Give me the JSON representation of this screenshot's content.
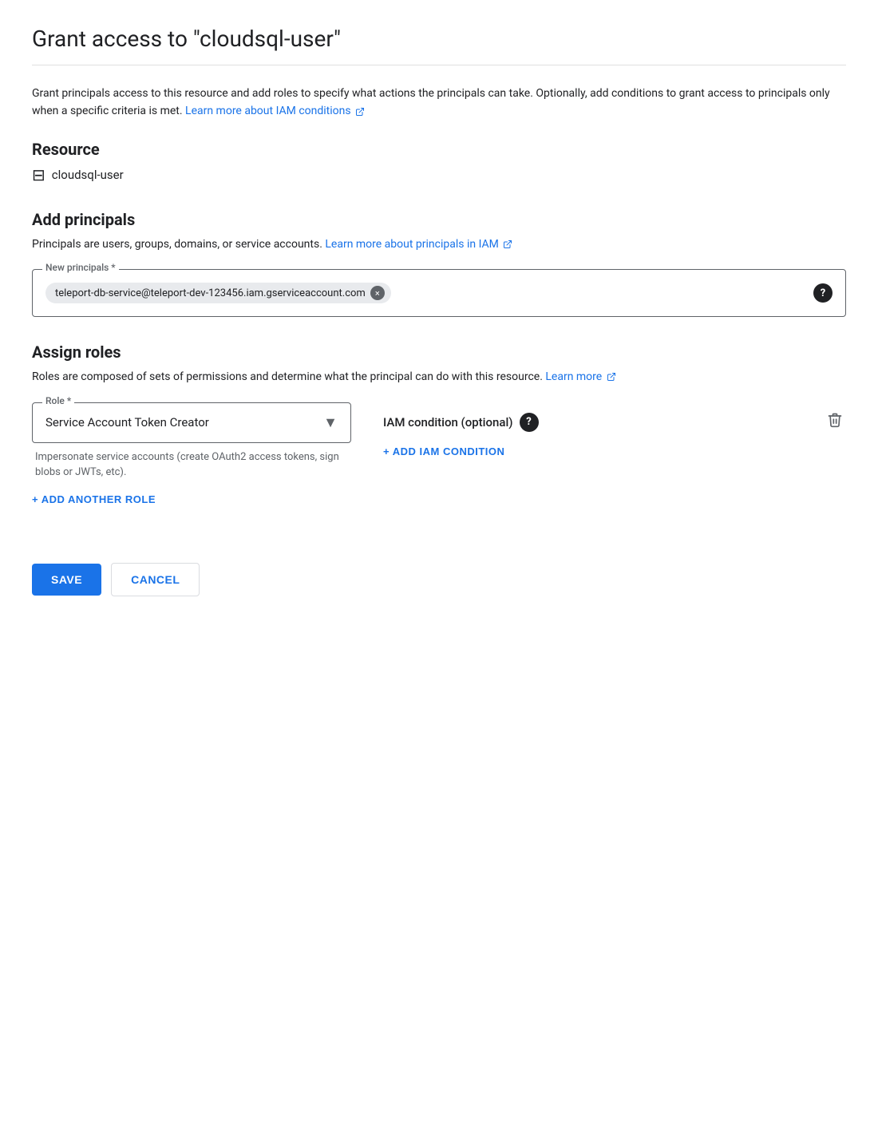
{
  "header": {
    "title": "Grant access to \"cloudsql-user\""
  },
  "description": {
    "text": "Grant principals access to this resource and add roles to specify what actions the principals can take. Optionally, add conditions to grant access to principals only when a specific criteria is met.",
    "link_text": "Learn more about IAM conditions",
    "link_icon": "↗"
  },
  "resource_section": {
    "title": "Resource",
    "icon": "⊟",
    "name": "cloudsql-user"
  },
  "add_principals_section": {
    "title": "Add principals",
    "description_text": "Principals are users, groups, domains, or service accounts.",
    "description_link": "Learn more about principals in IAM",
    "description_link_icon": "↗",
    "field_label": "New principals *",
    "chip_value": "teleport-db-service@teleport-dev-123456.iam.gserviceaccount.com",
    "chip_close_label": "×"
  },
  "assign_roles_section": {
    "title": "Assign roles",
    "description_text": "Roles are composed of sets of permissions and determine what the principal can do with this resource.",
    "description_link": "Learn more",
    "description_link_icon": "↗",
    "role_field_label": "Role *",
    "role_value": "Service Account Token Creator",
    "role_description": "Impersonate service accounts (create OAuth2 access tokens, sign blobs or JWTs, etc).",
    "iam_condition_label": "IAM condition (optional)",
    "add_condition_label": "+ ADD IAM CONDITION",
    "delete_label": "🗑",
    "add_another_role_label": "+ ADD ANOTHER ROLE"
  },
  "actions": {
    "save_label": "SAVE",
    "cancel_label": "CANCEL"
  }
}
